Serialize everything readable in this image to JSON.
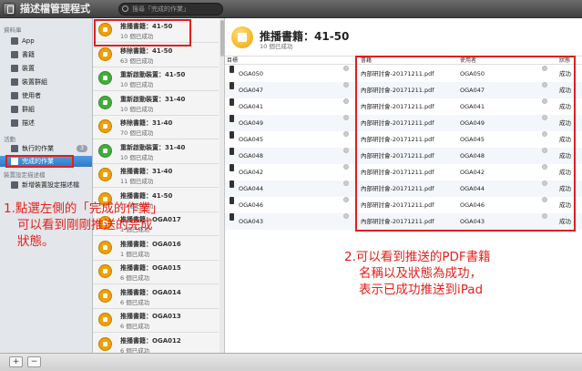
{
  "app": {
    "title": "描述檔管理程式",
    "search_placeholder": "搜尋「完成的作業」"
  },
  "sidebar": {
    "section_library": "資料庫",
    "items": [
      {
        "label": "App",
        "icon": "app-icon"
      },
      {
        "label": "書籍",
        "icon": "books-icon"
      },
      {
        "label": "裝置",
        "icon": "device-icon"
      },
      {
        "label": "裝置群組",
        "icon": "device-group-icon"
      },
      {
        "label": "使用者",
        "icon": "user-icon"
      },
      {
        "label": "群組",
        "icon": "group-icon"
      },
      {
        "label": "描述",
        "icon": "profile-icon"
      }
    ],
    "section_activity": "活動",
    "activity": [
      {
        "label": "執行的作業",
        "badge": "3"
      },
      {
        "label": "完成的作業"
      }
    ],
    "section_device_config": "裝置設定描述檔",
    "config_item": "新增裝置設定描述檔"
  },
  "queue": [
    {
      "title": "推播書籍：41-50",
      "status": "10 個已成功",
      "color": "#f0a100"
    },
    {
      "title": "移除書籍：41-50",
      "status": "63 個已成功",
      "color": "#f0a100"
    },
    {
      "title": "重新啟動裝置：41-50",
      "status": "10 個已成功",
      "color": "#3fae3a"
    },
    {
      "title": "重新啟動裝置：31-40",
      "status": "10 個已成功",
      "color": "#3fae3a"
    },
    {
      "title": "移除書籍：31-40",
      "status": "70 個已成功",
      "color": "#f0a100"
    },
    {
      "title": "重新啟動裝置：31-40",
      "status": "10 個已成功",
      "color": "#3fae3a"
    },
    {
      "title": "推播書籍：31-40",
      "status": "11 個已成功",
      "color": "#f0a100"
    },
    {
      "title": "推播書籍：41-50",
      "status": "10 個已成功",
      "color": "#f0a100"
    },
    {
      "title": "推播書籍：OGA017",
      "status": "1 個已成功",
      "color": "#f0a100"
    },
    {
      "title": "推播書籍：OGA016",
      "status": "1 個已成功",
      "color": "#f0a100"
    },
    {
      "title": "推播書籍：OGA015",
      "status": "6 個已成功",
      "color": "#f0a100"
    },
    {
      "title": "推播書籍：OGA014",
      "status": "6 個已成功",
      "color": "#f0a100"
    },
    {
      "title": "推播書籍：OGA013",
      "status": "6 個已成功",
      "color": "#f0a100"
    },
    {
      "title": "推播書籍：OGA012",
      "status": "6 個已成功",
      "color": "#f0a100"
    }
  ],
  "detail": {
    "title": "推播書籍：41-50",
    "subtitle": "10 個已成功",
    "columns": {
      "device": "目標",
      "book": "書籍",
      "user": "使用者",
      "status": "狀態"
    },
    "rows": [
      {
        "device": "OGA050",
        "book": "內部研討會-20171211.pdf",
        "user": "OGA050",
        "status": "成功"
      },
      {
        "device": "OGA047",
        "book": "內部研討會-20171211.pdf",
        "user": "OGA047",
        "status": "成功"
      },
      {
        "device": "OGA041",
        "book": "內部研討會-20171211.pdf",
        "user": "OGA041",
        "status": "成功"
      },
      {
        "device": "OGA049",
        "book": "內部研討會-20171211.pdf",
        "user": "OGA049",
        "status": "成功"
      },
      {
        "device": "OGA045",
        "book": "內部研討會-20171211.pdf",
        "user": "OGA045",
        "status": "成功"
      },
      {
        "device": "OGA048",
        "book": "內部研討會-20171211.pdf",
        "user": "OGA048",
        "status": "成功"
      },
      {
        "device": "OGA042",
        "book": "內部研討會-20171211.pdf",
        "user": "OGA042",
        "status": "成功"
      },
      {
        "device": "OGA044",
        "book": "內部研討會-20171211.pdf",
        "user": "OGA044",
        "status": "成功"
      },
      {
        "device": "OGA046",
        "book": "內部研討會-20171211.pdf",
        "user": "OGA046",
        "status": "成功"
      },
      {
        "device": "OGA043",
        "book": "內部研討會-20171211.pdf",
        "user": "OGA043",
        "status": "成功"
      }
    ]
  },
  "annotations": {
    "note1": [
      "1.點選左側的「完成的作業」",
      "可以看到剛剛推送的完成",
      "狀態。"
    ],
    "note2": [
      "2.可以看到推送的PDF書籍",
      "名稱以及狀態為成功，",
      "表示已成功推送到iPad"
    ]
  },
  "bottom": {
    "add": "+",
    "remove": "−"
  }
}
